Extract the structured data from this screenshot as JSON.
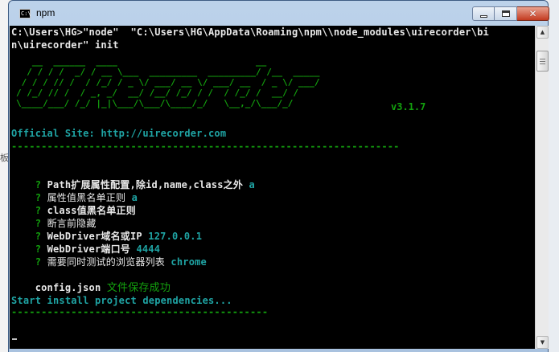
{
  "window": {
    "title": "npm",
    "icon": "console-window-icon",
    "icon_glyph": "C:\\"
  },
  "side_fragment": "板",
  "console": {
    "command_line_1": "C:\\Users\\HG>\"node\"  \"C:\\Users\\HG\\AppData\\Roaming\\npm\\\\node_modules\\uirecorder\\bi",
    "command_line_2": "n\\uirecorder\" init",
    "banner": [
      "   __  ______  ____                          __",
      "  / / / /  _/ / __ \\___  _________  _________/ /__  _____",
      " / / / // /  / /_/ / _ \\/ ___/ __ \\/ ___/ __  / _ \\/ ___/",
      "/ /_/ // /  / _, _/  __/ /__/ /_/ / /  / /_/ /  __/ /",
      "\\____/___/ /_/ |_|\\___/\\___/\\____/_/   \\__,_/\\___/_/"
    ],
    "version": "v3.1.7",
    "official_site": "Official Site: http://uirecorder.com",
    "divider_long": "-----------------------------------------------------------------",
    "prompts": [
      {
        "mark": "?",
        "question": "Path扩展属性配置,除id,name,class之外",
        "answer": "a"
      },
      {
        "mark": "?",
        "question": "属性值黑名单正则",
        "answer": "a"
      },
      {
        "mark": "?",
        "question": "class值黑名单正则",
        "answer": ""
      },
      {
        "mark": "?",
        "question": "断言前隐藏",
        "answer": ""
      },
      {
        "mark": "?",
        "question": "WebDriver域名或IP",
        "answer": "127.0.0.1"
      },
      {
        "mark": "?",
        "question": "WebDriver端口号",
        "answer": "4444"
      },
      {
        "mark": "?",
        "question": "需要同时测试的浏览器列表",
        "answer": "chrome"
      }
    ],
    "config_file": "config.json",
    "config_saved": "文件保存成功",
    "install_msg": "Start install project dependencies...",
    "divider_short": "-------------------------------------------",
    "cursor": "_"
  },
  "colors": {
    "console_bg": "#000000",
    "text_white": "#e8e8e8",
    "text_green": "#13a10e",
    "text_cyan": "#1fa4a4"
  }
}
